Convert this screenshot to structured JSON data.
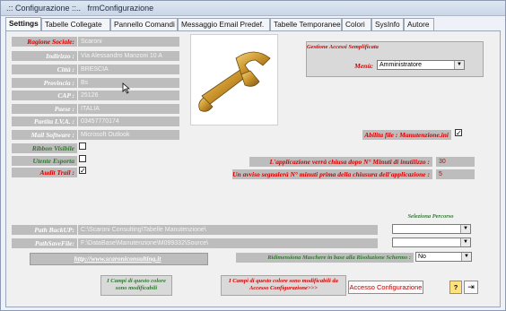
{
  "window": {
    "title": ".:: Configurazione ::..   frmConfigurazione"
  },
  "tabs": [
    "Settings",
    "Tabelle Collegate",
    "Pannello Comandi",
    "Messaggio Email Predef.",
    "Tabelle Temporanee",
    "Colori",
    "SysInfo",
    "Autore"
  ],
  "fields": [
    {
      "label": "Ragione Sociale:",
      "value": "Scaroni"
    },
    {
      "label": "Indirizzo :",
      "value": "Via Alessandro Manzoni 10 A"
    },
    {
      "label": "Città :",
      "value": "BRESCIA"
    },
    {
      "label": "Provincia :",
      "value": "Bs"
    },
    {
      "label": "CAP :",
      "value": "25126"
    },
    {
      "label": "Paese :",
      "value": "ITALIA"
    },
    {
      "label": "Partita I.V.A. :",
      "value": "03457770174"
    },
    {
      "label": "Mail Software :",
      "value": "Microsoft Outlook"
    }
  ],
  "checks": {
    "ribbon": {
      "label": "Ribbon Visibile",
      "checked": ""
    },
    "esporta": {
      "label": "Utente Esporta",
      "checked": ""
    },
    "audit": {
      "label": "Audit Trail :",
      "checked": "✓"
    }
  },
  "access": {
    "group_title": "Gestione Accessi Semplificata",
    "menu_label": "Menù:",
    "menu_value": "Amministratore"
  },
  "abilita": {
    "label": "Abilita file : Manutenzione.ini",
    "checked": "✓"
  },
  "timeouts": {
    "close_label": "L'applicazione verrà chiusa dopo N° Minuti di inutilizzo :",
    "close_value": "30",
    "warn_label": "Un avviso segnalerà N° minuti prima della chiusura dell'applicazione :",
    "warn_value": "5"
  },
  "paths": {
    "header": "Seleziona Percorso",
    "backup_label": "Path BackUP:",
    "backup_value": "C:\\Scaroni Consulting\\Tabelle Manutenzione\\",
    "save_label": "PathSaveFile:",
    "save_value": "F:\\DataBase\\Manutenzione\\M099332\\Source\\"
  },
  "website": "http://www.scaroniconsulting.it",
  "resize": {
    "label": "Ridimensiona Maschere in base alla Risoluzione Schermo :",
    "value": "No"
  },
  "notes": {
    "green": "I Campi di questo colore sono modificabili",
    "red": "I Campi di questo colore sono modificabili da Accesso Configurazione>>>"
  },
  "buttons": {
    "access_config": "Accesso Configurazione",
    "help": "?",
    "exit": "⇥"
  },
  "colors": {
    "label_bg": "#bdbdbd",
    "red_text": "#d40000",
    "green_text": "#2f7a2f"
  }
}
